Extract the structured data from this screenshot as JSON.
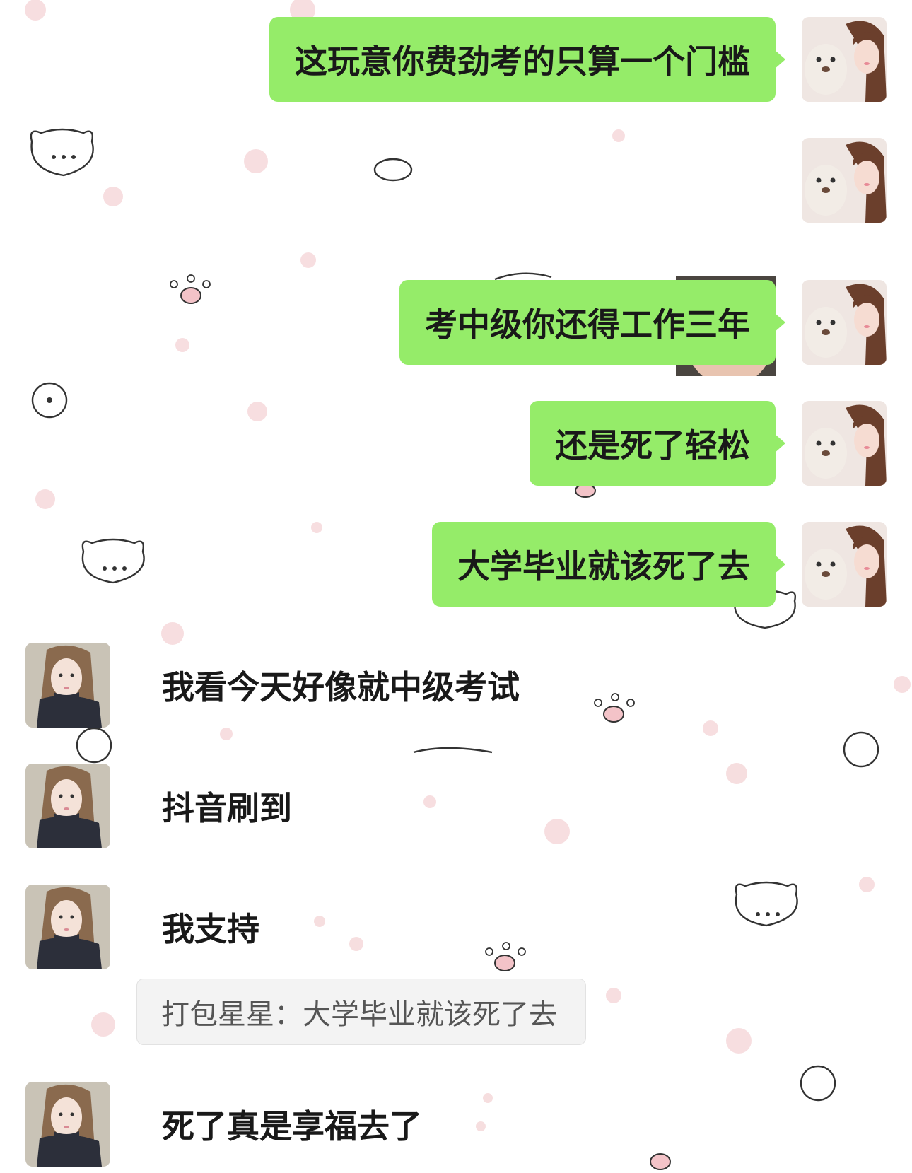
{
  "colors": {
    "self_bubble": "#95ec69",
    "text": "#191919",
    "quote_bg": "#f3f3f3",
    "quote_text": "#555555"
  },
  "icons": {
    "self_avatar": "girl-with-teddy-bear-avatar",
    "other_avatar": "girl-in-dark-sweater-avatar",
    "sticker": "baby-face-sticker"
  },
  "messages": {
    "m1": {
      "sender": "self",
      "text": "这玩意你费劲考的只算一个门槛"
    },
    "m2": {
      "sender": "self",
      "type": "sticker",
      "sticker": "baby-face-sticker"
    },
    "m3": {
      "sender": "self",
      "text": "考中级你还得工作三年"
    },
    "m4": {
      "sender": "self",
      "text": "还是死了轻松"
    },
    "m5": {
      "sender": "self",
      "text": "大学毕业就该死了去"
    },
    "m6": {
      "sender": "other",
      "text": "我看今天好像就中级考试"
    },
    "m7": {
      "sender": "other",
      "text": "抖音刷到"
    },
    "m8": {
      "sender": "other",
      "text": "我支持",
      "quote": "打包星星：大学毕业就该死了去"
    },
    "m9": {
      "sender": "other",
      "text": "死了真是享福去了"
    }
  }
}
